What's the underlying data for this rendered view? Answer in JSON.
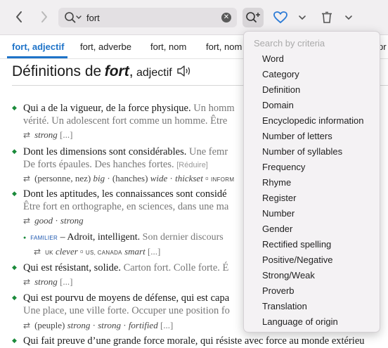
{
  "search": {
    "value": "fort"
  },
  "icons": {
    "back": "chevron-left-icon",
    "forward": "chevron-right-icon",
    "search": "magnifier-icon",
    "clear": "clear-icon",
    "criteria": "search-plus-icon",
    "favorite": "heart-icon",
    "favorite_menu": "chevron-down-icon",
    "trash": "trash-icon",
    "trash_menu": "chevron-down-icon",
    "audio": "speaker-icon"
  },
  "colors": {
    "accent": "#1e73c8",
    "bullet": "#1a8a3a",
    "heart": "#2b7ad6"
  },
  "tabs": [
    "fort, adjectif",
    "fort, adverbe",
    "fort, nom",
    "fort, nom",
    "pr"
  ],
  "heading": {
    "prefix": "Définitions de",
    "word": "fort",
    "comma": ",",
    "pos": "adjectif"
  },
  "definitions": [
    {
      "main": "Qui a de la vigueur, de la force physique.",
      "example": " Un homm",
      "cont": "vérité. Un adolescent fort comme un homme. Être"
    },
    {
      "main": "Dont les dimensions sont considérables.",
      "example": " Une femr",
      "cont": "De forts épaules. Des hanches fortes.",
      "reduce": "[Réduire]"
    },
    {
      "main": "Dont les aptitudes, les connaissances sont considé",
      "cont": "Être fort en orthographe, en sciences, dans une ma"
    },
    {
      "main": "Qui est résistant, solide.",
      "example": " Carton fort. Colle forte. É"
    },
    {
      "main": "Qui est pourvu de moyens de défense, qui est capa",
      "cont": "Une place, une ville forte. Occuper une position fo"
    },
    {
      "main": "Qui fait preuve d’une grande force morale, qui résiste avec force au monde extérieu"
    }
  ],
  "synonyms": {
    "s1": {
      "arrow": "⇄",
      "word": "strong",
      "more": "[...]"
    },
    "s2": {
      "arrow": "⇄",
      "ctx1": "(personne, nez)",
      "w1": "big",
      "ctx2": "(hanches)",
      "w2": "wide",
      "w3": "thickset",
      "tag": "INFORM"
    },
    "s3": {
      "arrow": "⇄",
      "w1": "good",
      "w2": "strong"
    },
    "s3b": {
      "tag": "FAMILIER",
      "dash": "–",
      "main": "Adroit, intelligent.",
      "example": " Son dernier discours"
    },
    "s3c": {
      "arrow": "⇄",
      "tag1": "UK",
      "w1": "clever",
      "tag2": "US, CANADA",
      "w2": "smart",
      "more": "[...]"
    },
    "s4": {
      "arrow": "⇄",
      "word": "strong",
      "more": "[...]"
    },
    "s5": {
      "arrow": "⇄",
      "ctx": "(peuple)",
      "w1": "strong",
      "w2": "strong",
      "w3": "fortified",
      "more": "[...]"
    }
  },
  "criteria_menu": {
    "placeholder": "Search by criteria",
    "items": [
      "Word",
      "Category",
      "Definition",
      "Domain",
      "Encyclopedic information",
      "Number of letters",
      "Number of syllables",
      "Frequency",
      "Rhyme",
      "Register",
      "Number",
      "Gender",
      "Rectified spelling",
      "Positive/Negative",
      "Strong/Weak",
      "Proverb",
      "Translation",
      "Language of origin"
    ]
  }
}
